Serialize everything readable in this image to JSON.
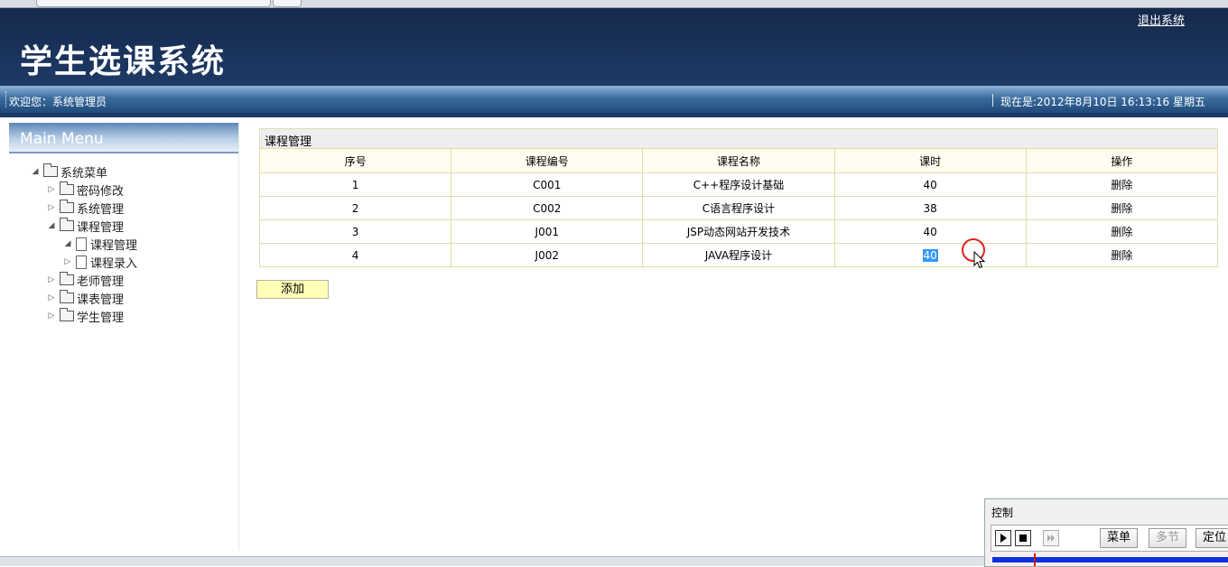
{
  "header": {
    "title": "学生选课系统",
    "logout_label": "退出系统"
  },
  "infobar": {
    "welcome": "欢迎您：系统管理员",
    "now": "现在是:2012年8月10日  16:13:16 星期五"
  },
  "sidebar": {
    "title": "Main Menu",
    "root": "系统菜单",
    "items": [
      {
        "label": "密码修改"
      },
      {
        "label": "系统管理"
      },
      {
        "label": "课程管理",
        "children": [
          {
            "label": "课程管理"
          },
          {
            "label": "课程录入"
          }
        ]
      },
      {
        "label": "老师管理"
      },
      {
        "label": "课表管理"
      },
      {
        "label": "学生管理"
      }
    ]
  },
  "panel": {
    "title": "课程管理",
    "columns": [
      "序号",
      "课程编号",
      "课程名称",
      "课时",
      "操作"
    ],
    "rows": [
      {
        "no": "1",
        "code": "C001",
        "name": "C++程序设计基础",
        "hours": "40",
        "action": "删除"
      },
      {
        "no": "2",
        "code": "C002",
        "name": "C语言程序设计",
        "hours": "38",
        "action": "删除"
      },
      {
        "no": "3",
        "code": "J001",
        "name": "JSP动态网站开发技术",
        "hours": "40",
        "action": "删除"
      },
      {
        "no": "4",
        "code": "J002",
        "name": "JAVA程序设计",
        "hours": "40",
        "action": "删除"
      }
    ],
    "add_label": "添加"
  },
  "control": {
    "title": "控制",
    "menu_label": "菜单",
    "multi_label": "多节",
    "locate_label": "定位"
  },
  "colors": {
    "header_bg": "#1a3358",
    "table_border": "#e3dcaa",
    "add_button_bg": "#ffffb8",
    "selection": "#3399ff"
  }
}
